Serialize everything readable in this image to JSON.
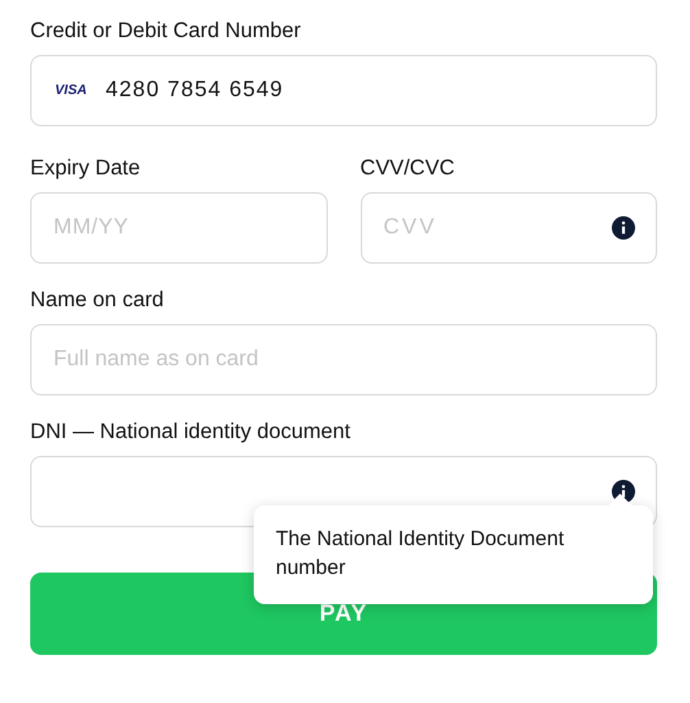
{
  "card_number": {
    "label": "Credit or Debit Card Number",
    "brand": "VISA",
    "value": "4280 7854 6549"
  },
  "expiry": {
    "label": "Expiry Date",
    "placeholder": "MM/YY"
  },
  "cvv": {
    "label": "CVV/CVC",
    "placeholder": "CVV",
    "info": true
  },
  "name": {
    "label": "Name on card",
    "placeholder": "Full name as on card"
  },
  "dni": {
    "label": "DNI — National identity document",
    "info": true,
    "tooltip": "The National Identity Document number"
  },
  "pay_button": {
    "label": "PAY"
  }
}
